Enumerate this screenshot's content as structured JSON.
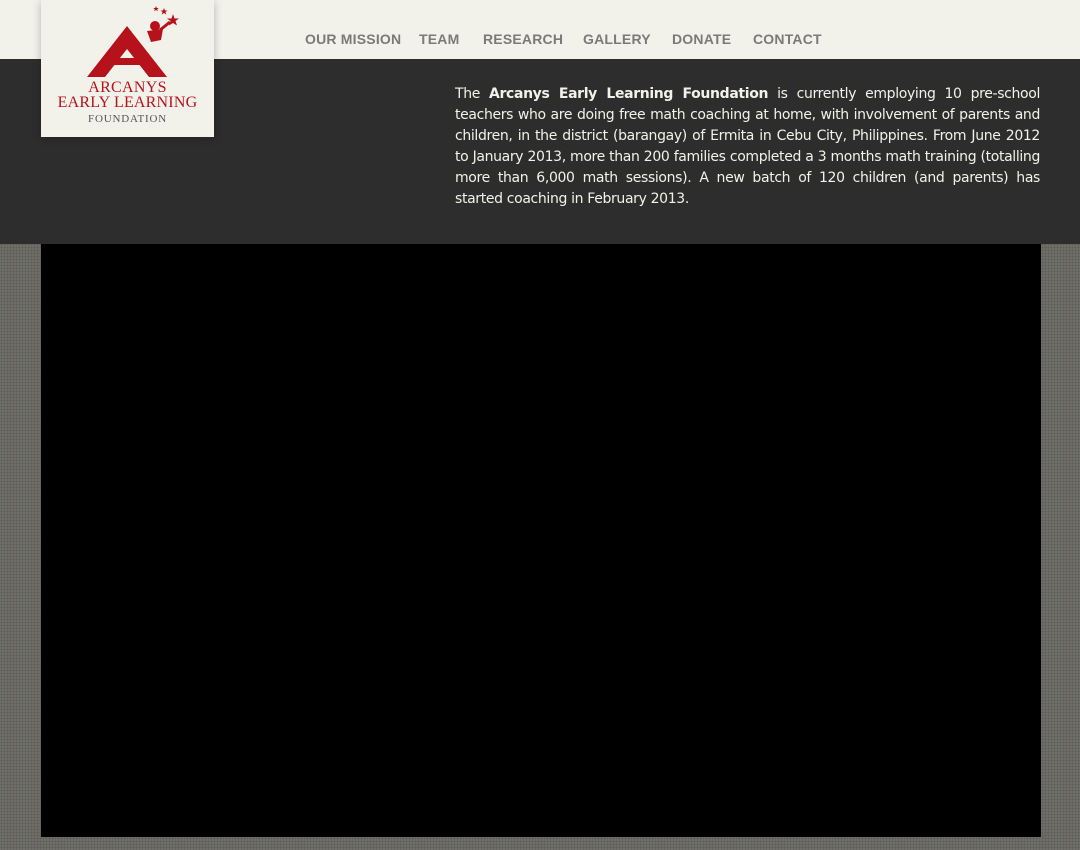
{
  "brand": {
    "line1": "ARCANYS",
    "line2": "EARLY LEARNING",
    "line3": "FOUNDATION",
    "color": "#b5121b"
  },
  "nav": {
    "items": [
      {
        "label": "OUR MISSION"
      },
      {
        "label": "TEAM"
      },
      {
        "label": "RESEARCH"
      },
      {
        "label": "GALLERY"
      },
      {
        "label": "DONATE"
      },
      {
        "label": "CONTACT"
      }
    ]
  },
  "intro": {
    "lead": "The ",
    "org_name": "Arcanys Early Learning Foundation",
    "body": " is currently employing 10 pre-school teachers who are doing free math coaching at home, with involvement of parents and children, in the district (barangay) of Ermita in Cebu City, Philippines. From June 2012 to January 2013, more than 200 families completed a 3 months math training (totalling more than 6,000 math sessions). A new batch of 120 children (and parents) has started coaching in February 2013."
  },
  "colors": {
    "header_bg": "#f2f2eb",
    "hero_bg": "#2d2d2d",
    "nav_text": "#7a7a76",
    "intro_text": "#f2f2ea",
    "page_bg": "#6f6f68",
    "video_bg": "#000000"
  }
}
